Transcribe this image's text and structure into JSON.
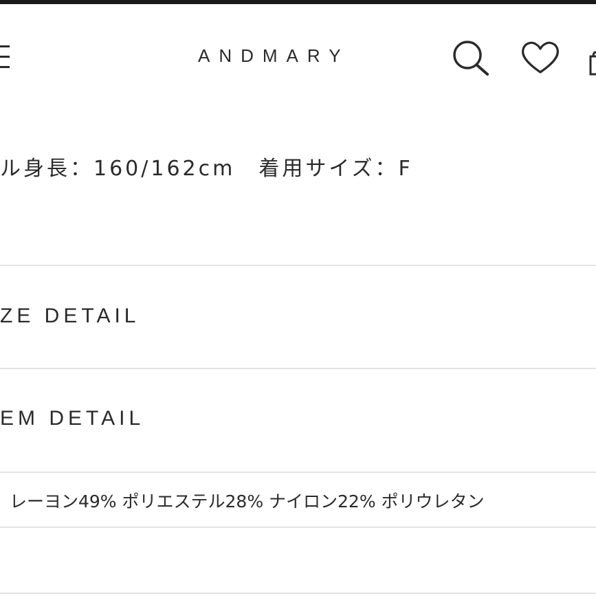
{
  "header": {
    "logo": "ANDMARY",
    "icons": [
      "menu-icon",
      "search-icon",
      "heart-icon",
      "bag-icon"
    ]
  },
  "product": {
    "model_info": "ル身長：160/162cm　着用サイズ：F"
  },
  "sections": {
    "size_detail": "ZE DETAIL",
    "item_detail": "EM DETAIL"
  },
  "material": {
    "text": "レーヨン49% ポリエステル28% ナイロン22% ポリウレタン"
  }
}
